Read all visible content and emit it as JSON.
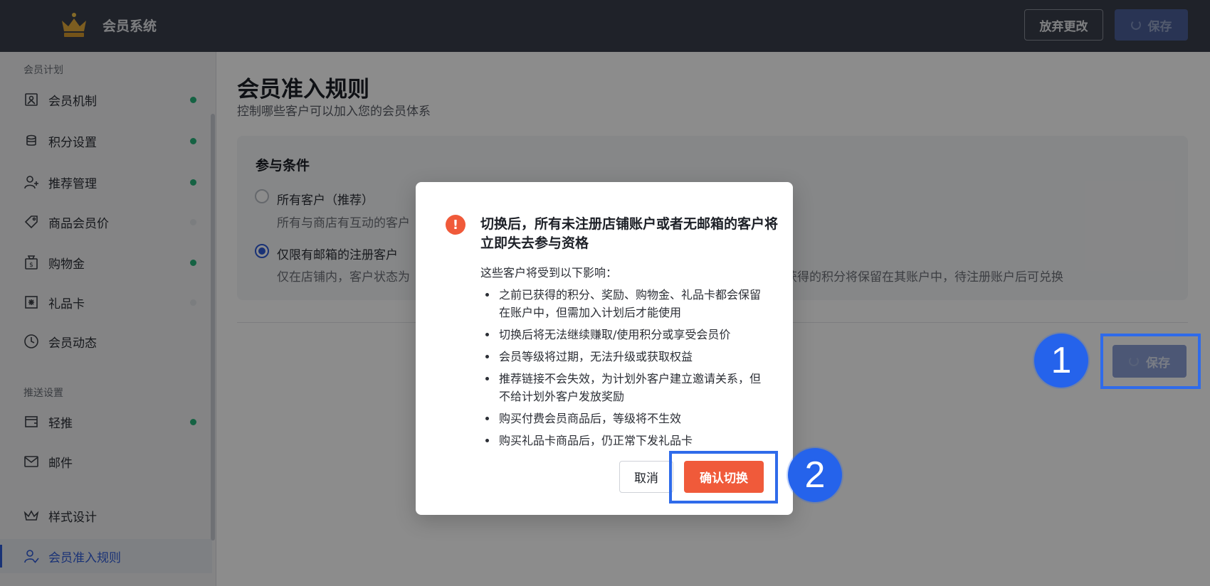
{
  "header": {
    "app_title": "会员系统",
    "discard_label": "放弃更改",
    "save_label": "保存"
  },
  "sidebar": {
    "section_plan": "会员计划",
    "section_push": "推送设置",
    "items": [
      {
        "label": "会员机制",
        "icon": "member-mechanism-icon",
        "status": "on"
      },
      {
        "label": "积分设置",
        "icon": "coins-icon",
        "status": "on"
      },
      {
        "label": "推荐管理",
        "icon": "user-add-icon",
        "status": "on"
      },
      {
        "label": "商品会员价",
        "icon": "tag-icon",
        "status": "off"
      },
      {
        "label": "购物金",
        "icon": "money-bag-icon",
        "status": "on"
      },
      {
        "label": "礼品卡",
        "icon": "gift-card-icon",
        "status": "off"
      },
      {
        "label": "会员动态",
        "icon": "clock-icon",
        "status": "none"
      },
      {
        "label": "轻推",
        "icon": "nudge-icon",
        "status": "on"
      },
      {
        "label": "邮件",
        "icon": "mail-icon",
        "status": "none"
      },
      {
        "label": "样式设计",
        "icon": "crown-outline-icon",
        "status": "none"
      },
      {
        "label": "会员准入规则",
        "icon": "user-check-icon",
        "status": "active"
      }
    ]
  },
  "main": {
    "title": "会员准入规则",
    "subtitle": "控制哪些客户可以加入您的会员体系",
    "card_title": "参与条件",
    "option_all_label": "所有客户（推荐）",
    "option_all_desc": "所有与商店有互动的客户",
    "option_email_label": "仅限有邮箱的注册客户",
    "option_email_desc_left": "仅在店铺内，客户状态为",
    "option_email_desc_right": "获得的积分将保留在其账户中，待注册账户后可兑换",
    "save_label": "保存"
  },
  "dialog": {
    "title": "切换后，所有未注册店铺账户或者无邮箱的客户将立即失去参与资格",
    "intro": "这些客户将受到以下影响：",
    "bullets": [
      "之前已获得的积分、奖励、购物金、礼品卡都会保留在账户中，但需加入计划后才能使用",
      "切换后将无法继续赚取/使用积分或享受会员价",
      "会员等级将过期，无法升级或获取权益",
      "推荐链接不会失效，为计划外客户建立邀请关系，但不给计划外客户发放奖励",
      "购买付费会员商品后，等级将不生效",
      "购买礼品卡商品后，仍正常下发礼品卡"
    ],
    "cancel_label": "取消",
    "confirm_label": "确认切换"
  },
  "annotations": {
    "badge_1": "1",
    "badge_2": "2"
  },
  "colors": {
    "header_bg": "#3a3f4b",
    "primary": "#2e5bd8",
    "danger": "#f05a3a",
    "status_on": "#27b37a",
    "annotation_blue": "#2563eb"
  }
}
